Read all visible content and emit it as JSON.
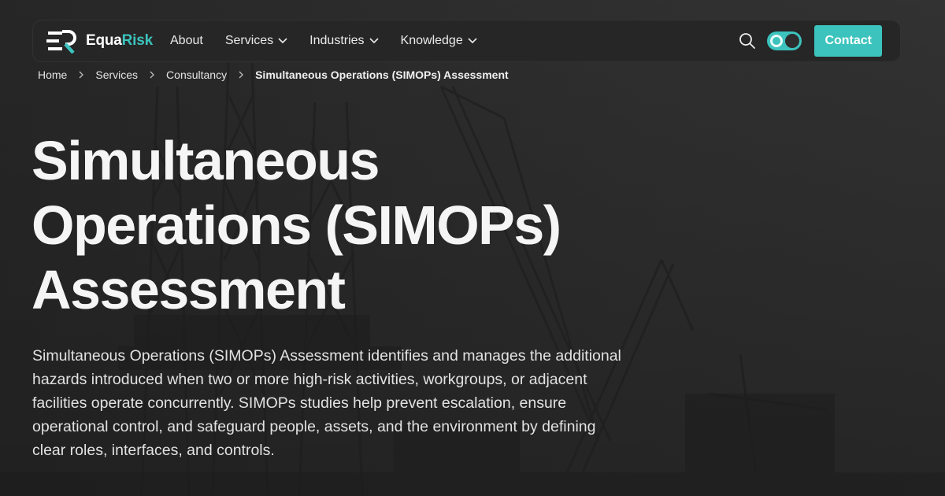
{
  "brand": {
    "name_part1": "Equa",
    "name_part2": "Risk",
    "accent_color": "#3cc3bd"
  },
  "nav": {
    "items": [
      {
        "label": "About",
        "has_dropdown": false
      },
      {
        "label": "Services",
        "has_dropdown": true
      },
      {
        "label": "Industries",
        "has_dropdown": true
      },
      {
        "label": "Knowledge",
        "has_dropdown": true
      }
    ],
    "search_icon": "search-icon",
    "theme_toggle_state": "on",
    "contact_label": "Contact"
  },
  "breadcrumb": {
    "items": [
      "Home",
      "Services",
      "Consultancy",
      "Simultaneous Operations (SIMOPs) Assessment"
    ]
  },
  "hero": {
    "title_lines": [
      "Simultaneous",
      "Operations (SIMOPs)",
      "Assessment"
    ],
    "description_lines": [
      "Simultaneous Operations (SIMOPs) Assessment identifies and manages the additional",
      "hazards introduced when two or more high-risk activities, workgroups, or adjacent",
      "facilities operate concurrently. SIMOPs studies help prevent escalation, ensure",
      "operational control, and safeguard people, assets, and the environment by defining",
      "clear roles, interfaces, and controls."
    ]
  }
}
